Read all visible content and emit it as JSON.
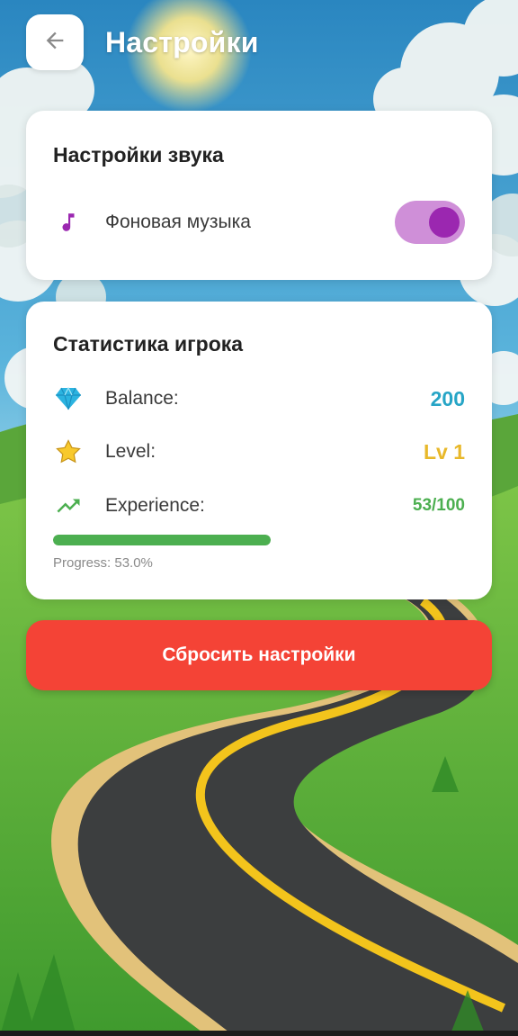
{
  "header": {
    "title": "Настройки",
    "back_icon": "arrow-left-icon"
  },
  "sound_settings": {
    "title": "Настройки звука",
    "music_label": "Фоновая музыка",
    "music_icon": "music-note-icon",
    "music_enabled": true
  },
  "player_stats": {
    "title": "Статистика игрока",
    "balance": {
      "label": "Balance:",
      "value": "200",
      "icon": "diamond-icon",
      "color": "#26a5c6"
    },
    "level": {
      "label": "Level:",
      "value": "Lv 1",
      "icon": "star-icon",
      "color": "#e8b82a"
    },
    "experience": {
      "label": "Experience:",
      "value": "53/100",
      "icon": "trending-up-icon",
      "color": "#4caf50"
    },
    "progress_fraction": 0.53,
    "progress_text": "Progress: 53.0%"
  },
  "reset_button": {
    "label": "Сбросить настройки",
    "color": "#f44336"
  },
  "colors": {
    "accent_purple": "#9b27b0",
    "toggle_track": "#cf8fd8"
  }
}
